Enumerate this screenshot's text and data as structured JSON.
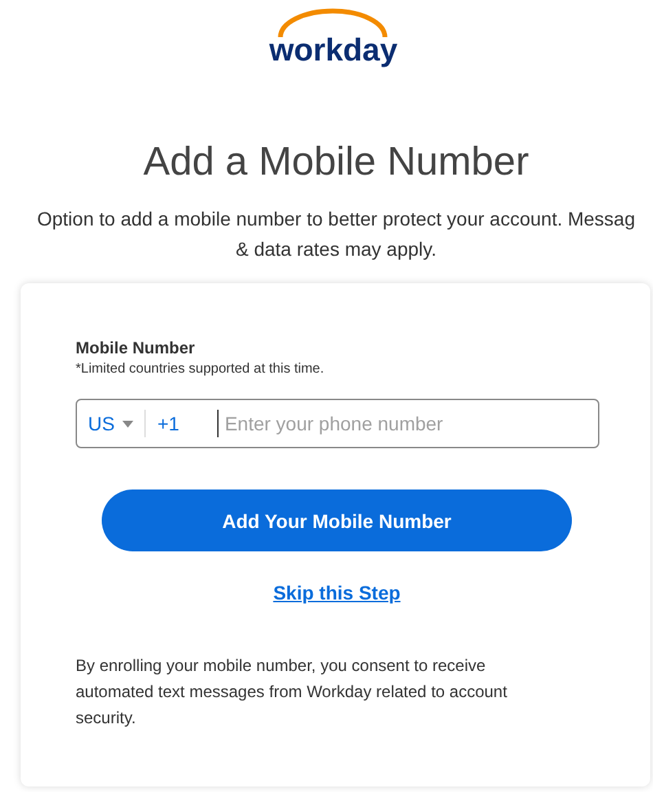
{
  "logo": {
    "text": "workday"
  },
  "title": "Add a Mobile Number",
  "subtitle_lines": [
    "Option to add a mobile number to better protect your account. Messag",
    "& data rates may apply."
  ],
  "form": {
    "label": "Mobile Number",
    "note": "*Limited countries supported at this time.",
    "country": "US",
    "dial_code": "+1",
    "placeholder": "Enter your phone number"
  },
  "primary_button": "Add Your Mobile Number",
  "skip_link": "Skip this Step",
  "consent": "By enrolling your mobile number, you consent to receive automated text messages from Workday related to account security."
}
